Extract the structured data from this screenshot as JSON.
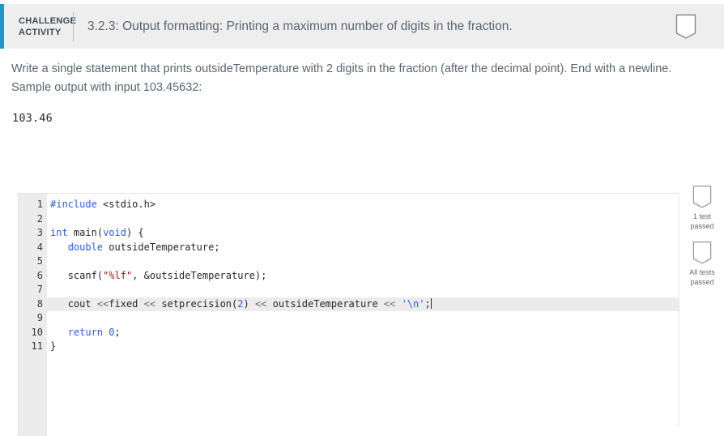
{
  "header": {
    "accent_color": "#2196c9",
    "label_line1": "CHALLENGE",
    "label_line2": "ACTIVITY",
    "title": "3.2.3: Output formatting: Printing a maximum number of digits in the fraction.",
    "flag_icon": "pennant-icon"
  },
  "prompt": {
    "text": "Write a single statement that prints outsideTemperature with 2 digits in the fraction (after the decimal point). End with a newline. Sample output with input 103.45632:",
    "sample_output": "103.46"
  },
  "editor": {
    "line_numbers": [
      "1",
      "2",
      "3",
      "4",
      "5",
      "6",
      "7",
      "8",
      "9",
      "10",
      "11"
    ],
    "active_line": 8,
    "lines": [
      {
        "n": "1",
        "text": "#include <stdio.h>"
      },
      {
        "n": "2",
        "text": ""
      },
      {
        "n": "3",
        "text": "int main(void) {"
      },
      {
        "n": "4",
        "text": "   double outsideTemperature;"
      },
      {
        "n": "5",
        "text": ""
      },
      {
        "n": "6",
        "text": "   scanf(\"%lf\", &outsideTemperature);"
      },
      {
        "n": "7",
        "text": ""
      },
      {
        "n": "8",
        "text": "   cout <<fixed << setprecision(2) << outsideTemperature << '\\n';"
      },
      {
        "n": "9",
        "text": ""
      },
      {
        "n": "10",
        "text": "   return 0;"
      },
      {
        "n": "11",
        "text": "}"
      }
    ]
  },
  "test_rail": {
    "items": [
      {
        "icon": "pennant-icon",
        "caption": "1 test passed"
      },
      {
        "icon": "pennant-icon",
        "caption": "All tests passed"
      }
    ]
  }
}
